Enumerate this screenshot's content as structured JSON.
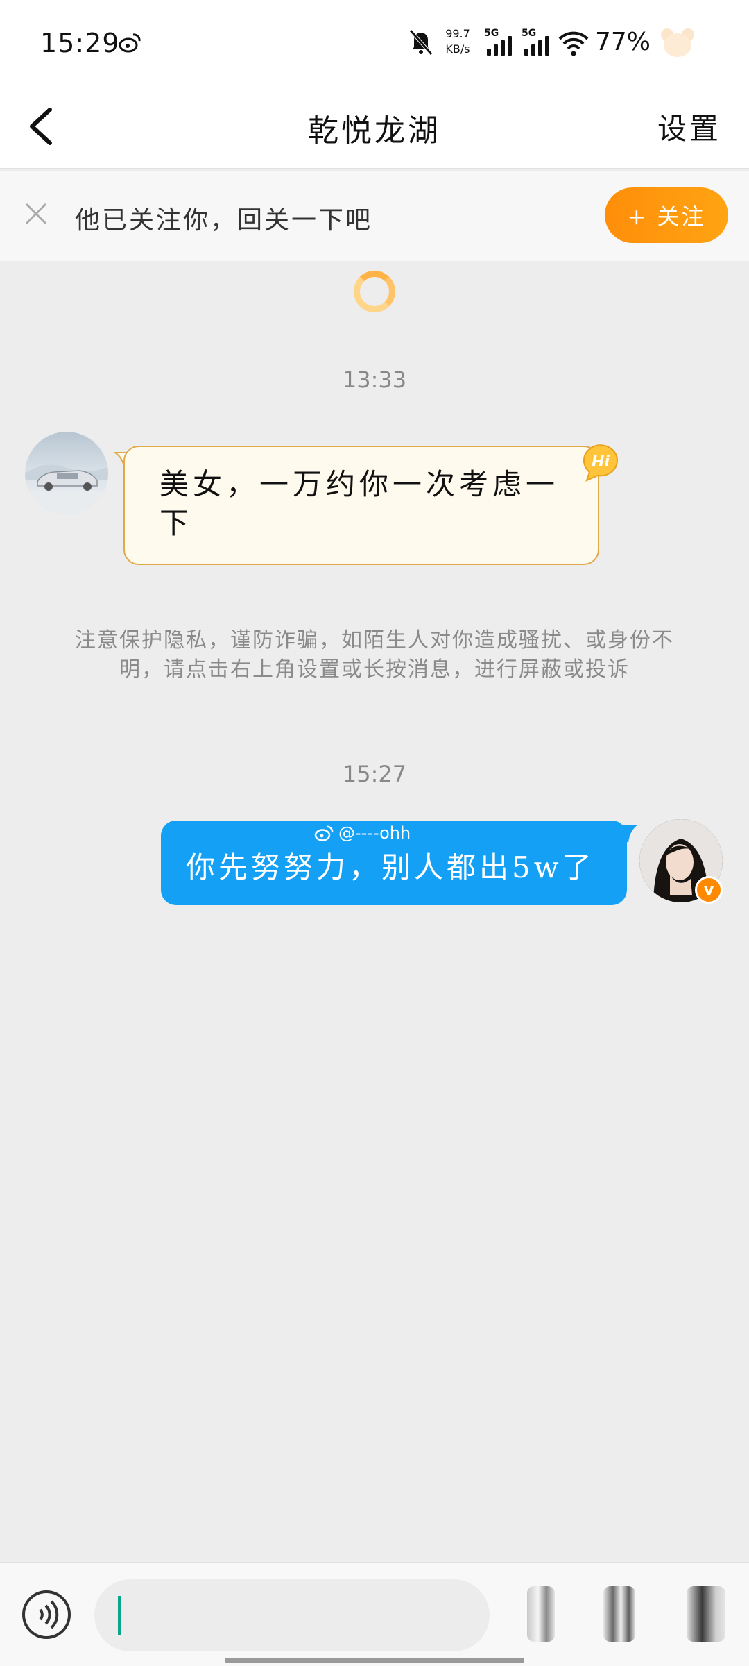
{
  "status_bar": {
    "time": "15:29",
    "net_speed_value": "99.7",
    "net_speed_unit": "KB/s",
    "sim1_label": "5G",
    "sim2_label": "5G",
    "battery": "77%",
    "icons": [
      "weibo-icon",
      "bell-off-icon",
      "signal-icon",
      "wifi-icon",
      "bear-icon"
    ]
  },
  "nav": {
    "title": "乾悦龙湖",
    "settings_label": "设置"
  },
  "follow_banner": {
    "text": "他已关注你，回关一下吧",
    "button_label": "+ 关注"
  },
  "messages": [
    {
      "type": "timestamp",
      "text": "13:33"
    },
    {
      "type": "incoming",
      "text": "美女，一万约你一次考虑一下",
      "badge": "Hi"
    },
    {
      "type": "notice",
      "text": "注意保护隐私，谨防诈骗，如陌生人对你造成骚扰、或身份不明，请点击右上角设置或长按消息，进行屏蔽或投诉"
    },
    {
      "type": "timestamp",
      "text": "15:27"
    },
    {
      "type": "outgoing",
      "text": "你先努努力，别人都出5w了"
    }
  ],
  "watermark": "@----ohh",
  "verified_badge": "v",
  "input_bar": {
    "placeholder": ""
  },
  "colors": {
    "accent_orange": "#ff9a0e",
    "outgoing_bubble": "#14a0f5",
    "incoming_bubble": "#fffaee",
    "background": "#ededed"
  }
}
